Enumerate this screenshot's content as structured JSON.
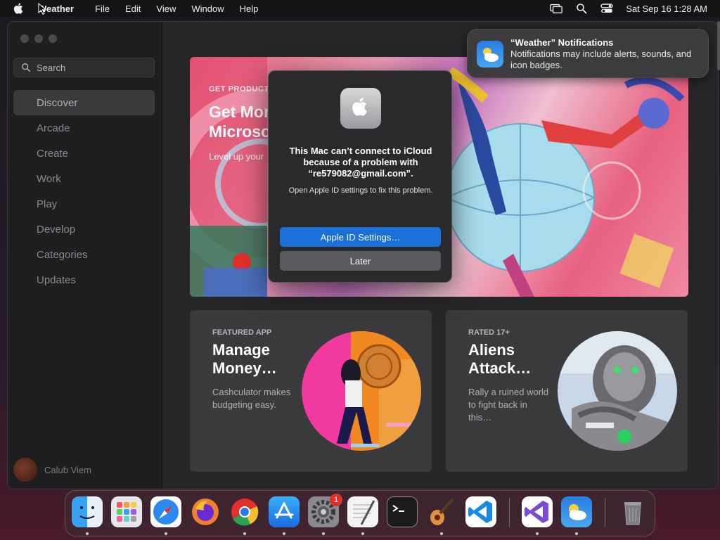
{
  "menubar": {
    "app_name": "Weather",
    "items": [
      "File",
      "Edit",
      "View",
      "Window",
      "Help"
    ],
    "clock": "Sat Sep 16  1:28 AM"
  },
  "sidebar": {
    "search_placeholder": "Search",
    "items": [
      {
        "label": "Discover",
        "active": true
      },
      {
        "label": "Arcade"
      },
      {
        "label": "Create"
      },
      {
        "label": "Work"
      },
      {
        "label": "Play"
      },
      {
        "label": "Develop"
      },
      {
        "label": "Categories"
      },
      {
        "label": "Updates"
      }
    ],
    "user_name": "Calub Viem"
  },
  "hero": {
    "eyebrow": "GET PRODUCTI",
    "title_line1": "Get Mor",
    "title_line2": "Microso",
    "subtitle": "Level up your"
  },
  "cards": [
    {
      "eyebrow": "FEATURED APP",
      "title": "Manage Money…",
      "desc": "Cashculator makes budgeting easy."
    },
    {
      "eyebrow": "RATED 17+",
      "title": "Aliens Attack…",
      "desc": "Rally a ruined world to fight back in this…"
    }
  ],
  "notification": {
    "title": "“Weather” Notifications",
    "body": "Notifications may include alerts, sounds, and icon badges."
  },
  "dialog": {
    "title": "This Mac can’t connect to iCloud because of a problem with “re579082@gmail.com”.",
    "message": "Open Apple ID settings to fix this problem.",
    "primary_label": "Apple ID Settings…",
    "secondary_label": "Later"
  },
  "dock": {
    "apps": [
      "finder",
      "launchpad",
      "safari",
      "firefox",
      "chrome",
      "app-store",
      "system-settings",
      "textedit",
      "terminal",
      "garageband",
      "vscode",
      "visual-studio",
      "weather",
      "trash"
    ],
    "system_settings_badge": "1"
  },
  "colors": {
    "accent": "#1a6fd8",
    "badge": "#e0302a"
  }
}
